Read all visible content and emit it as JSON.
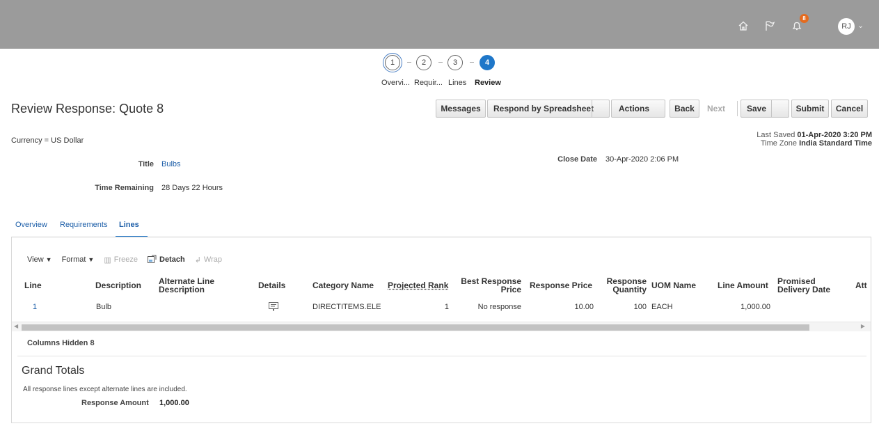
{
  "header": {
    "home_icon": "home-icon",
    "flag_icon": "flag-icon",
    "notifications_icon": "bell-icon",
    "notification_count": "8",
    "user_initials": "RJ"
  },
  "train": {
    "steps": [
      {
        "number": "1",
        "label": "Overvi..."
      },
      {
        "number": "2",
        "label": "Requir..."
      },
      {
        "number": "3",
        "label": "Lines"
      },
      {
        "number": "4",
        "label": "Review"
      }
    ]
  },
  "page": {
    "title": "Review Response: Quote 8"
  },
  "buttons": {
    "messages": "Messages",
    "respond_by_spreadsheet": "Respond by Spreadsheet",
    "actions": "Actions",
    "back": "Back",
    "next": "Next",
    "save": "Save",
    "submit": "Submit",
    "cancel": "Cancel"
  },
  "info": {
    "currency": "Currency = US Dollar",
    "last_saved_label": "Last Saved",
    "last_saved_value": "01-Apr-2020 3:20 PM",
    "time_zone_label": "Time Zone",
    "time_zone_value": "India Standard Time",
    "title_label": "Title",
    "title_value": "Bulbs",
    "time_remaining_label": "Time Remaining",
    "time_remaining_value": "28 Days 22 Hours",
    "close_date_label": "Close Date",
    "close_date_value": "30-Apr-2020 2:06 PM"
  },
  "tabs": [
    "Overview",
    "Requirements",
    "Lines"
  ],
  "toolbar": {
    "view": "View",
    "format": "Format",
    "freeze": "Freeze",
    "detach": "Detach",
    "wrap": "Wrap"
  },
  "table": {
    "columns": {
      "line": "Line",
      "description": "Description",
      "alt_line_desc": "Alternate Line Description",
      "details": "Details",
      "category_name": "Category Name",
      "projected_rank": "Projected Rank",
      "best_response_price": "Best Response Price",
      "response_price": "Response Price",
      "response_quantity": "Response Quantity",
      "uom_name": "UOM Name",
      "line_amount": "Line Amount",
      "promised_delivery_date": "Promised Delivery Date",
      "attachments": "Att"
    },
    "rows": [
      {
        "line": "1",
        "description": "Bulb",
        "alt_line_desc": "",
        "details_icon": "details-icon",
        "category_name": "DIRECTITEMS.ELE",
        "projected_rank": "1",
        "best_response_price": "No response",
        "response_price": "10.00",
        "response_quantity": "100",
        "uom_name": "EACH",
        "line_amount": "1,000.00",
        "promised_delivery_date": ""
      }
    ],
    "columns_hidden_label": "Columns Hidden",
    "columns_hidden_count": "8"
  },
  "grand_totals": {
    "title": "Grand Totals",
    "note": "All response lines except alternate lines are included.",
    "response_amount_label": "Response Amount",
    "response_amount_value": "1,000.00"
  }
}
